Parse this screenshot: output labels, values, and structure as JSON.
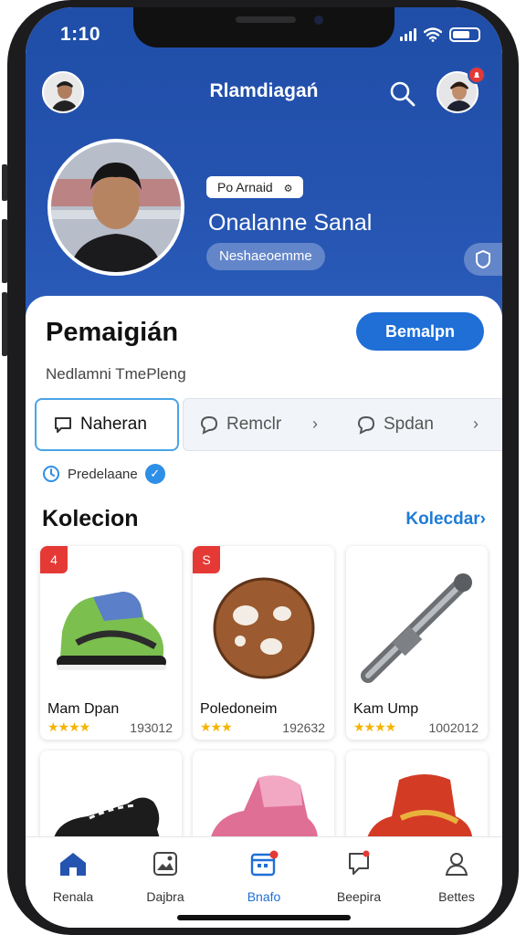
{
  "status": {
    "time": "1:10"
  },
  "header": {
    "title": "Rlamdiagań",
    "notification_count": ""
  },
  "profile": {
    "badge": "Po Arnaid",
    "name": "Onalanne Sanal",
    "tag": "Neshaeoemme"
  },
  "section": {
    "title": "Pemaigián",
    "action_label": "Bemalpn",
    "subtitle": "Nedlamni TmePleng"
  },
  "tabs": [
    {
      "label": "Naheran",
      "active": true
    },
    {
      "label": "Remclr",
      "active": false
    },
    {
      "label": "Spdan",
      "active": false
    }
  ],
  "info": {
    "text": "Predelaane"
  },
  "collection": {
    "title": "Kolecion",
    "link": "Kolecdar›",
    "products": [
      {
        "name": "Mam Dpan",
        "count": "193012",
        "rating": "★★★★",
        "corner": "4",
        "icon": "sneaker-icon"
      },
      {
        "name": "Poledoneim",
        "count": "192632",
        "rating": "★★★",
        "corner": "S",
        "icon": "leather-ball-icon"
      },
      {
        "name": "Kam Ump",
        "count": "1002012",
        "rating": "★★★★",
        "corner": "",
        "icon": "metal-tube-icon"
      },
      {
        "name": "",
        "count": "",
        "rating": "",
        "corner": "",
        "icon": "black-shoe-icon"
      },
      {
        "name": "",
        "count": "",
        "rating": "",
        "corner": "",
        "icon": "pink-sneaker-icon"
      },
      {
        "name": "",
        "count": "",
        "rating": "",
        "corner": "",
        "icon": "red-sneaker-icon"
      }
    ]
  },
  "nav": [
    {
      "label": "Renala",
      "icon": "home-icon",
      "active": false
    },
    {
      "label": "Dajbra",
      "icon": "gallery-icon",
      "active": false
    },
    {
      "label": "Bnafo",
      "icon": "calendar-icon",
      "active": true
    },
    {
      "label": "Beepira",
      "icon": "chat-icon",
      "active": false
    },
    {
      "label": "Bettes",
      "icon": "profile-icon",
      "active": false
    }
  ],
  "colors": {
    "brand_blue": "#2553b0",
    "accent": "#1f6fd6",
    "badge_red": "#e53935",
    "star": "#f5b400"
  }
}
